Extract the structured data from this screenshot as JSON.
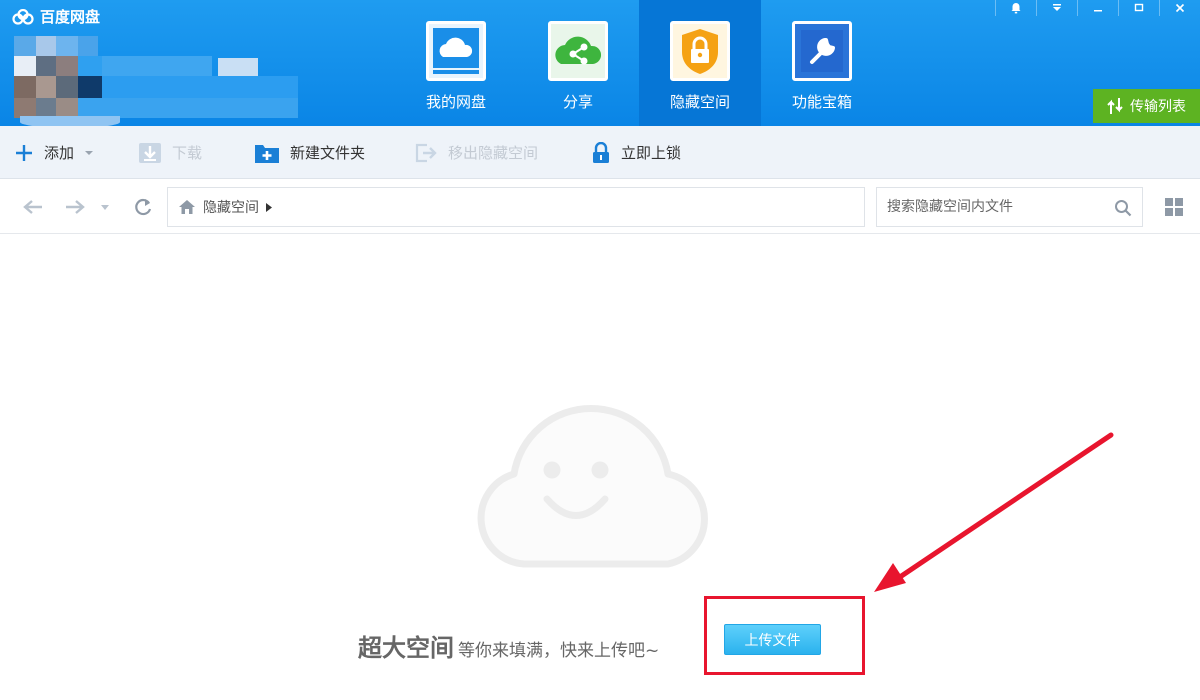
{
  "app": {
    "title": "百度网盘",
    "logo_icon": "baidu-cloud-logo"
  },
  "nav": {
    "tabs": [
      {
        "label": "我的网盘",
        "icon": "cloud-disk-icon",
        "active": false
      },
      {
        "label": "分享",
        "icon": "share-icon",
        "active": false
      },
      {
        "label": "隐藏空间",
        "icon": "lock-icon",
        "active": true
      },
      {
        "label": "功能宝箱",
        "icon": "wrench-icon",
        "active": false
      }
    ]
  },
  "window_controls": [
    "notification-icon",
    "menu-icon",
    "minimize-icon",
    "maximize-icon",
    "close-icon"
  ],
  "transfer_button": {
    "label": "传输列表",
    "icon": "transfer-icon",
    "color": "#5db322"
  },
  "toolbar": {
    "add": {
      "label": "添加",
      "enabled": true
    },
    "download": {
      "label": "下载",
      "enabled": false
    },
    "new_folder": {
      "label": "新建文件夹",
      "enabled": true
    },
    "move_out": {
      "label": "移出隐藏空间",
      "enabled": false
    },
    "lock_now": {
      "label": "立即上锁",
      "enabled": true
    }
  },
  "addressbar": {
    "breadcrumb": [
      "隐藏空间"
    ],
    "search_placeholder": "搜索隐藏空间内文件"
  },
  "empty_state": {
    "title": "超大空间",
    "subtitle": "等你来填满，快来上传吧~",
    "upload_button": "上传文件"
  },
  "colors": {
    "header": "#0a85e6",
    "active_tab": "#0676d6",
    "upload_button": "#2bb2ee",
    "highlight": "#e8152e"
  }
}
